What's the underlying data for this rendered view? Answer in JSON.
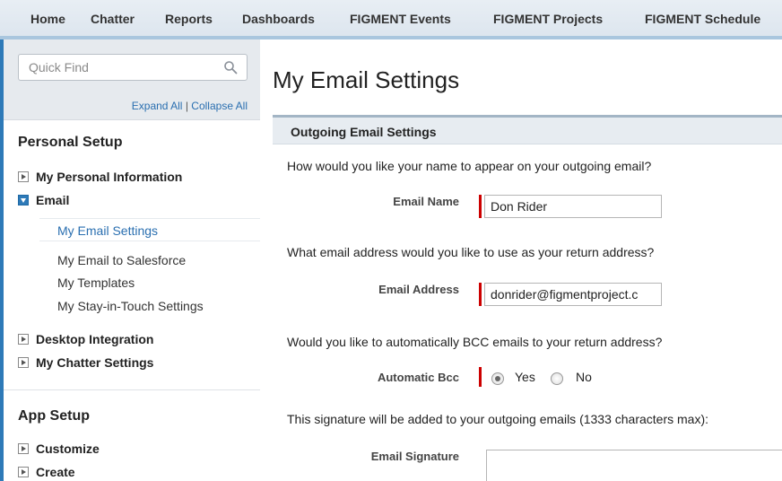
{
  "nav": {
    "tabs": [
      "Home",
      "Chatter",
      "Reports",
      "Dashboards",
      "FIGMENT Events",
      "FIGMENT Projects",
      "FIGMENT Schedule"
    ]
  },
  "sidebar": {
    "search_placeholder": "Quick Find",
    "search_icon": "magnifier",
    "expand_all": "Expand All",
    "separator": "|",
    "collapse_all": "Collapse All",
    "personal_setup": {
      "heading": "Personal Setup",
      "items": [
        {
          "label": "My Personal Information",
          "expanded": false
        },
        {
          "label": "Email",
          "expanded": true,
          "children": [
            "My Email Settings",
            "My Email to Salesforce",
            "My Templates",
            "My Stay-in-Touch Settings"
          ],
          "selected": "My Email Settings"
        },
        {
          "label": "Desktop Integration",
          "expanded": false
        },
        {
          "label": "My Chatter Settings",
          "expanded": false
        }
      ]
    },
    "app_setup": {
      "heading": "App Setup",
      "items": [
        {
          "label": "Customize",
          "expanded": false
        },
        {
          "label": "Create",
          "expanded": false
        }
      ]
    }
  },
  "main": {
    "title": "My Email Settings",
    "panel_title": "Outgoing Email Settings",
    "q_name": "How would you like your name to appear on your outgoing email?",
    "email_name_label": "Email Name",
    "email_name_value": "Don Rider",
    "q_address": "What email address would you like to use as your return address?",
    "email_address_label": "Email Address",
    "email_address_value": "donrider@figmentproject.c",
    "q_bcc": "Would you like to automatically BCC emails to your return address?",
    "bcc_label": "Automatic Bcc",
    "bcc_yes": "Yes",
    "bcc_no": "No",
    "bcc_selected": "Yes",
    "q_signature": "This signature will be added to your outgoing emails (1333 characters max):",
    "signature_label": "Email Signature",
    "signature_value": ""
  },
  "colors": {
    "accent_blue": "#2e7ab8",
    "link_blue": "#2a6fb0",
    "required_red": "#cc0000"
  }
}
